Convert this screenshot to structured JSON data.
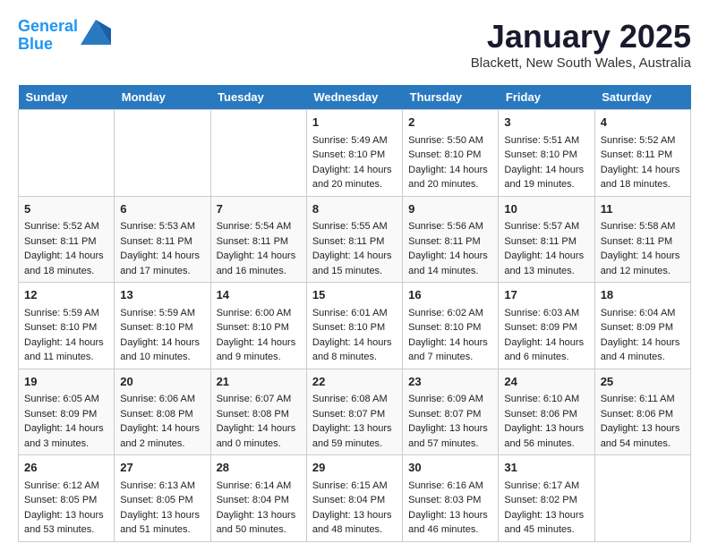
{
  "header": {
    "logo_line1": "General",
    "logo_line2": "Blue",
    "month": "January 2025",
    "location": "Blackett, New South Wales, Australia"
  },
  "weekdays": [
    "Sunday",
    "Monday",
    "Tuesday",
    "Wednesday",
    "Thursday",
    "Friday",
    "Saturday"
  ],
  "weeks": [
    [
      {
        "day": "",
        "info": ""
      },
      {
        "day": "",
        "info": ""
      },
      {
        "day": "",
        "info": ""
      },
      {
        "day": "1",
        "info": "Sunrise: 5:49 AM\nSunset: 8:10 PM\nDaylight: 14 hours and 20 minutes."
      },
      {
        "day": "2",
        "info": "Sunrise: 5:50 AM\nSunset: 8:10 PM\nDaylight: 14 hours and 20 minutes."
      },
      {
        "day": "3",
        "info": "Sunrise: 5:51 AM\nSunset: 8:10 PM\nDaylight: 14 hours and 19 minutes."
      },
      {
        "day": "4",
        "info": "Sunrise: 5:52 AM\nSunset: 8:11 PM\nDaylight: 14 hours and 18 minutes."
      }
    ],
    [
      {
        "day": "5",
        "info": "Sunrise: 5:52 AM\nSunset: 8:11 PM\nDaylight: 14 hours and 18 minutes."
      },
      {
        "day": "6",
        "info": "Sunrise: 5:53 AM\nSunset: 8:11 PM\nDaylight: 14 hours and 17 minutes."
      },
      {
        "day": "7",
        "info": "Sunrise: 5:54 AM\nSunset: 8:11 PM\nDaylight: 14 hours and 16 minutes."
      },
      {
        "day": "8",
        "info": "Sunrise: 5:55 AM\nSunset: 8:11 PM\nDaylight: 14 hours and 15 minutes."
      },
      {
        "day": "9",
        "info": "Sunrise: 5:56 AM\nSunset: 8:11 PM\nDaylight: 14 hours and 14 minutes."
      },
      {
        "day": "10",
        "info": "Sunrise: 5:57 AM\nSunset: 8:11 PM\nDaylight: 14 hours and 13 minutes."
      },
      {
        "day": "11",
        "info": "Sunrise: 5:58 AM\nSunset: 8:11 PM\nDaylight: 14 hours and 12 minutes."
      }
    ],
    [
      {
        "day": "12",
        "info": "Sunrise: 5:59 AM\nSunset: 8:10 PM\nDaylight: 14 hours and 11 minutes."
      },
      {
        "day": "13",
        "info": "Sunrise: 5:59 AM\nSunset: 8:10 PM\nDaylight: 14 hours and 10 minutes."
      },
      {
        "day": "14",
        "info": "Sunrise: 6:00 AM\nSunset: 8:10 PM\nDaylight: 14 hours and 9 minutes."
      },
      {
        "day": "15",
        "info": "Sunrise: 6:01 AM\nSunset: 8:10 PM\nDaylight: 14 hours and 8 minutes."
      },
      {
        "day": "16",
        "info": "Sunrise: 6:02 AM\nSunset: 8:10 PM\nDaylight: 14 hours and 7 minutes."
      },
      {
        "day": "17",
        "info": "Sunrise: 6:03 AM\nSunset: 8:09 PM\nDaylight: 14 hours and 6 minutes."
      },
      {
        "day": "18",
        "info": "Sunrise: 6:04 AM\nSunset: 8:09 PM\nDaylight: 14 hours and 4 minutes."
      }
    ],
    [
      {
        "day": "19",
        "info": "Sunrise: 6:05 AM\nSunset: 8:09 PM\nDaylight: 14 hours and 3 minutes."
      },
      {
        "day": "20",
        "info": "Sunrise: 6:06 AM\nSunset: 8:08 PM\nDaylight: 14 hours and 2 minutes."
      },
      {
        "day": "21",
        "info": "Sunrise: 6:07 AM\nSunset: 8:08 PM\nDaylight: 14 hours and 0 minutes."
      },
      {
        "day": "22",
        "info": "Sunrise: 6:08 AM\nSunset: 8:07 PM\nDaylight: 13 hours and 59 minutes."
      },
      {
        "day": "23",
        "info": "Sunrise: 6:09 AM\nSunset: 8:07 PM\nDaylight: 13 hours and 57 minutes."
      },
      {
        "day": "24",
        "info": "Sunrise: 6:10 AM\nSunset: 8:06 PM\nDaylight: 13 hours and 56 minutes."
      },
      {
        "day": "25",
        "info": "Sunrise: 6:11 AM\nSunset: 8:06 PM\nDaylight: 13 hours and 54 minutes."
      }
    ],
    [
      {
        "day": "26",
        "info": "Sunrise: 6:12 AM\nSunset: 8:05 PM\nDaylight: 13 hours and 53 minutes."
      },
      {
        "day": "27",
        "info": "Sunrise: 6:13 AM\nSunset: 8:05 PM\nDaylight: 13 hours and 51 minutes."
      },
      {
        "day": "28",
        "info": "Sunrise: 6:14 AM\nSunset: 8:04 PM\nDaylight: 13 hours and 50 minutes."
      },
      {
        "day": "29",
        "info": "Sunrise: 6:15 AM\nSunset: 8:04 PM\nDaylight: 13 hours and 48 minutes."
      },
      {
        "day": "30",
        "info": "Sunrise: 6:16 AM\nSunset: 8:03 PM\nDaylight: 13 hours and 46 minutes."
      },
      {
        "day": "31",
        "info": "Sunrise: 6:17 AM\nSunset: 8:02 PM\nDaylight: 13 hours and 45 minutes."
      },
      {
        "day": "",
        "info": ""
      }
    ]
  ]
}
